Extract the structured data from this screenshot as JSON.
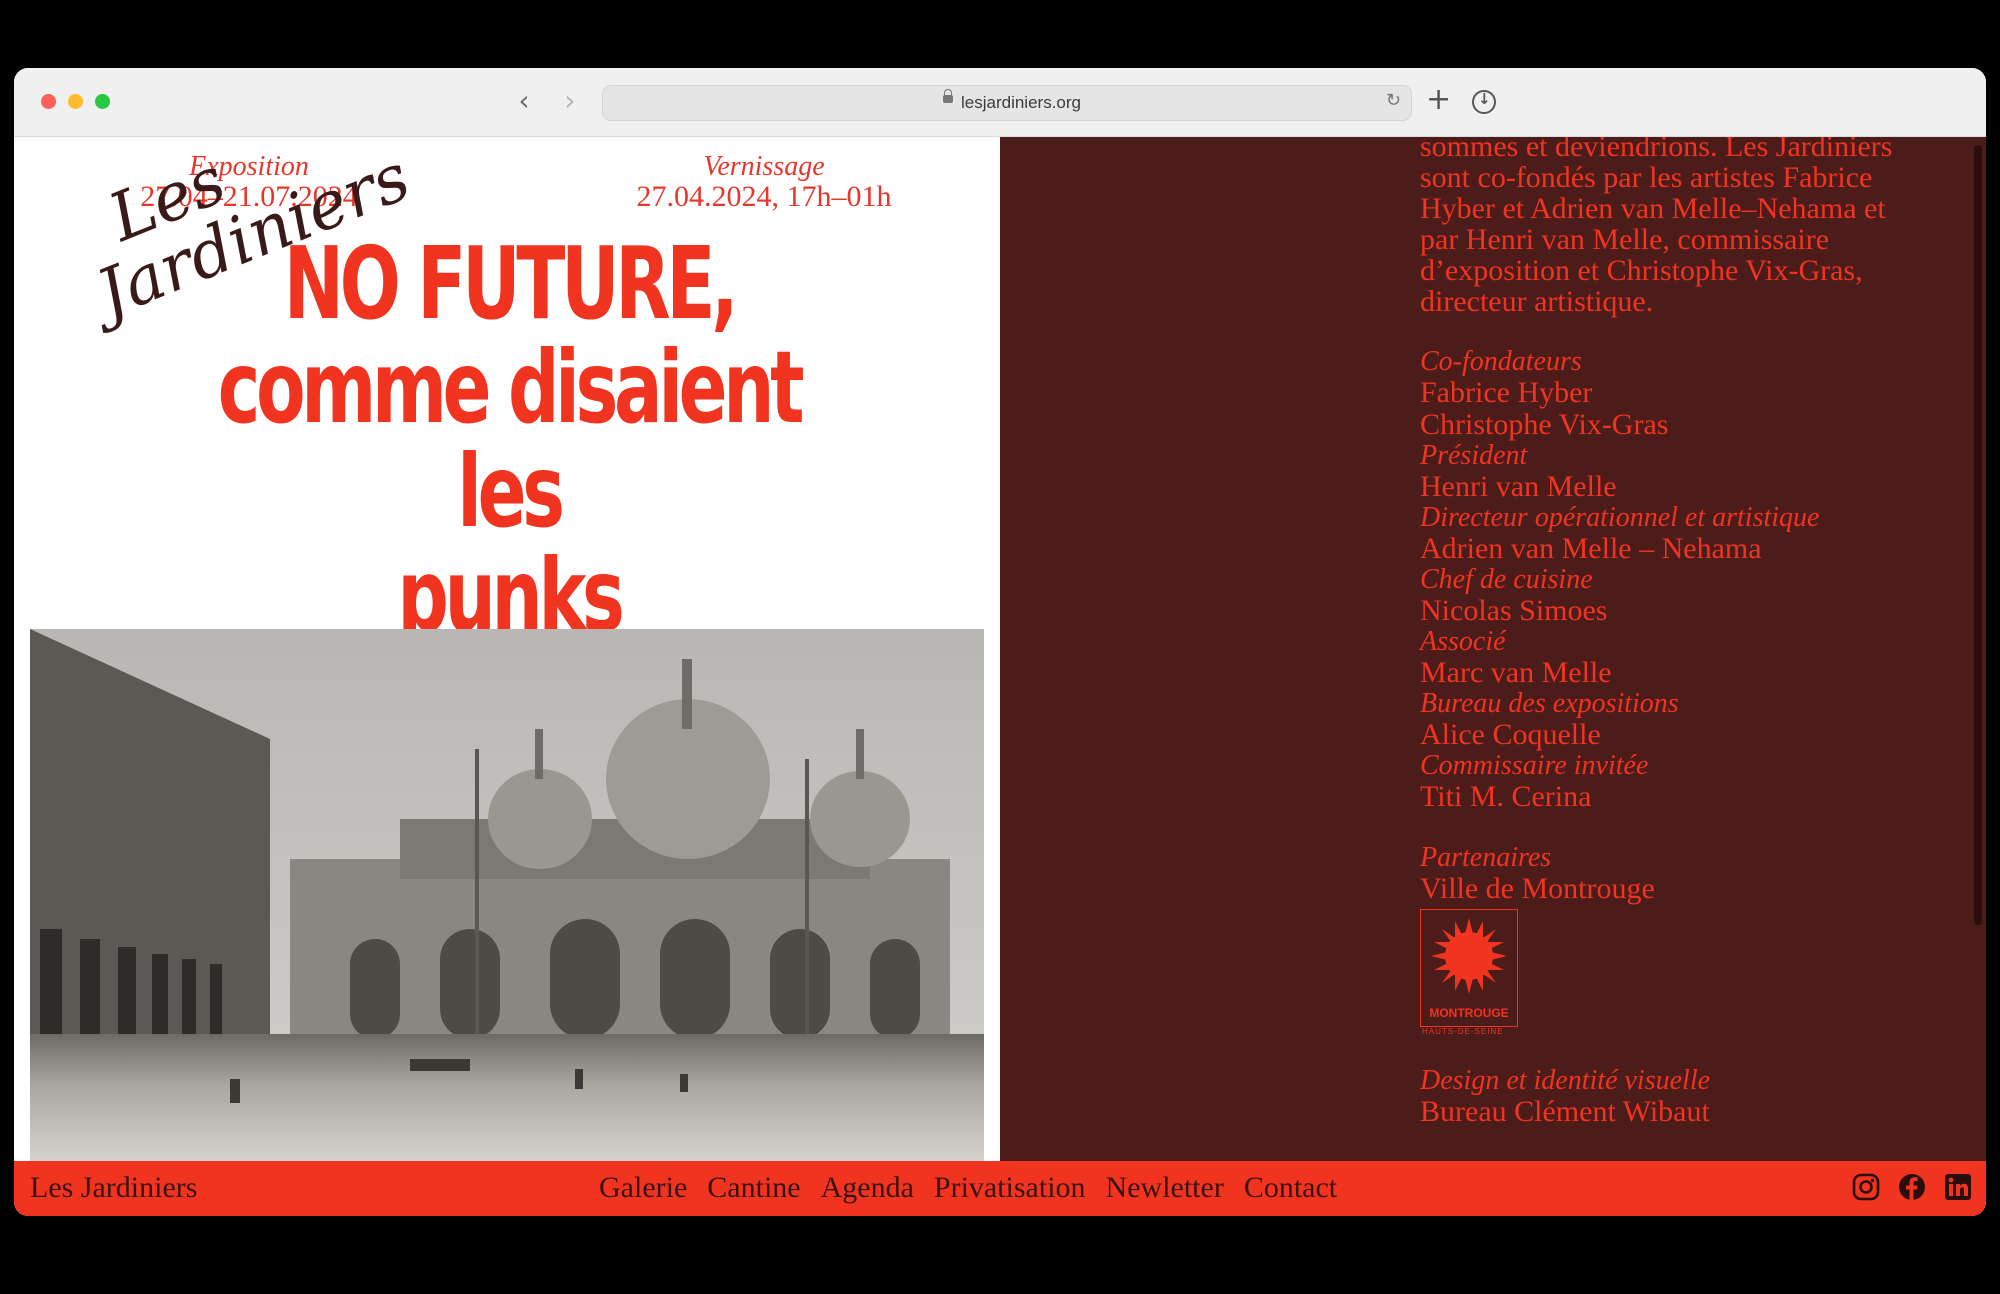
{
  "browser": {
    "url": "lesjardiniers.org"
  },
  "poster": {
    "exposition_label": "Exposition",
    "exposition_dates": "27.04–21.07.2024",
    "vernissage_label": "Vernissage",
    "vernissage_dates": "27.04.2024, 17h–01h",
    "logo_line1": "Les",
    "logo_line2": "Jardiniers",
    "headline_line1": "NO FUTURE,",
    "headline_line2": "comme disaient les",
    "headline_line3": "punks"
  },
  "credits": {
    "intro_line1": "sommes et deviendrions. Les Jardiniers",
    "intro_line2": "sont co-fondés par les artistes Fabrice",
    "intro_line3": "Hyber et Adrien van Melle–Nehama et",
    "intro_line4": "par Henri van Melle, commissaire",
    "intro_line5": "d’exposition et Christophe Vix-Gras,",
    "intro_line6": "directeur artistique.",
    "cofounders_label": "Co-fondateurs",
    "cofounder_1": "Fabrice Hyber",
    "cofounder_2": "Christophe Vix-Gras",
    "president_label": "Président",
    "president": "Henri van Melle",
    "director_label": "Directeur opérationnel et artistique",
    "director": "Adrien van Melle – Nehama",
    "chef_label": "Chef de cuisine",
    "chef": "Nicolas Simoes",
    "associate_label": "Associé",
    "associate": "Marc van Melle",
    "office_label": "Bureau des expositions",
    "office": "Alice Coquelle",
    "curator_label": "Commissaire invitée",
    "curator": "Titi M. Cerina",
    "partners_label": "Partenaires",
    "partner": "Ville de Montrouge",
    "partner_logo_name": "MONTROUGE",
    "partner_logo_sub": "HAUTS-DE-SEINE",
    "design_label": "Design et identité visuelle",
    "design": "Bureau Clément Wibaut"
  },
  "footer": {
    "site_name": "Les Jardiniers",
    "nav": [
      "Galerie",
      "Cantine",
      "Agenda",
      "Privatisation",
      "Newletter",
      "Contact"
    ],
    "social_icons": [
      "instagram-icon",
      "facebook-icon",
      "linkedin-icon"
    ]
  },
  "colors": {
    "accent_red": "#f0341f",
    "panel_maroon": "#4c1c1b",
    "footer_text": "#3a1210"
  }
}
